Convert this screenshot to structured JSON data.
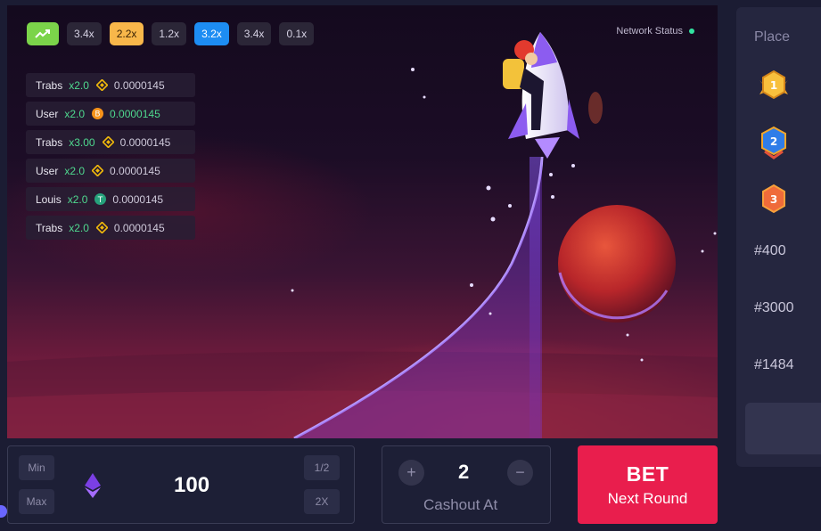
{
  "multipliers": [
    {
      "label": "",
      "icon": "trend-up-icon",
      "style": "trend"
    },
    {
      "label": "3.4x",
      "style": "default"
    },
    {
      "label": "2.2x",
      "style": "orange"
    },
    {
      "label": "1.2x",
      "style": "default"
    },
    {
      "label": "3.2x",
      "style": "blue"
    },
    {
      "label": "3.4x",
      "style": "default"
    },
    {
      "label": "0.1x",
      "style": "default"
    }
  ],
  "network_status": {
    "label": "Network Status",
    "color": "#32e2a0"
  },
  "feed": [
    {
      "user": "Trabs",
      "multiplier": "x2.0",
      "coin": "bnb-coin-icon",
      "amount": "0.0000145",
      "highlight": false
    },
    {
      "user": "User",
      "multiplier": "x2.0",
      "coin": "bitcoin-coin-icon",
      "amount": "0.0000145",
      "highlight": true
    },
    {
      "user": "Trabs",
      "multiplier": "x3.00",
      "coin": "bnb-coin-icon",
      "amount": "0.0000145",
      "highlight": false
    },
    {
      "user": "User",
      "multiplier": "x2.0",
      "coin": "bnb-coin-icon",
      "amount": "0.0000145",
      "highlight": false
    },
    {
      "user": "Louis",
      "multiplier": "x2.0",
      "coin": "tether-coin-icon",
      "amount": "0.0000145",
      "highlight": false
    },
    {
      "user": "Trabs",
      "multiplier": "x2.0",
      "coin": "bnb-coin-icon",
      "amount": "0.0000145",
      "highlight": false
    }
  ],
  "bet_panel": {
    "min_label": "Min",
    "max_label": "Max",
    "half_label": "1/2",
    "double_label": "2X",
    "currency_icon": "ethereum-icon",
    "amount": "100"
  },
  "cashout": {
    "value": "2",
    "label": "Cashout At",
    "plus_label": "+",
    "minus_label": "−"
  },
  "bet_button": {
    "title": "BET",
    "subtitle": "Next Round",
    "color": "#e91e4d"
  },
  "leaderboard": {
    "title": "Place",
    "badges": [
      {
        "rank": "1",
        "icon": "gold-badge-icon"
      },
      {
        "rank": "2",
        "icon": "blue-badge-icon"
      },
      {
        "rank": "3",
        "icon": "orange-badge-icon"
      }
    ],
    "ranks": [
      "#400",
      "#3000",
      "#1484"
    ]
  }
}
